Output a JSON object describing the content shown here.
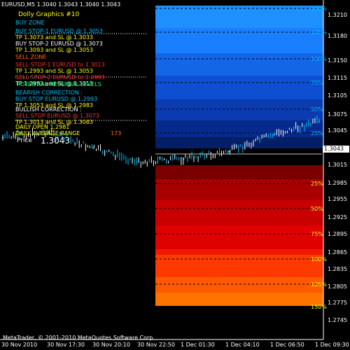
{
  "window": {
    "title": "EURUSD,M5  1.3040 1.3043 1.3040 1.3043"
  },
  "panel": {
    "header": "Dolly Graphics #10",
    "buy_zone": "BUY ZONE",
    "buy_stop1": "BUY STOP-1  EURUSD  @  1.3053",
    "buy_stop1_tp": "TP 1.3073   and SL @  1.3033",
    "buy_stop2": "BUY STOP-2  EURUSD  @  1.3073",
    "buy_stop2_tp": "TP 1.3093   and SL @  1.3053",
    "sell_zone": "SELL ZONE",
    "sell_stop1": "SELL STOP-1  EURUSD  to 1.3013",
    "sell_stop1_tp": "TP 1.2993   and SL @  1.3053",
    "sell_stop2": "SELL STOP-2  EURUSD  to 1.2993",
    "sell_stop2_tp": "TP 1.2983   and SL @  1.3013",
    "reversal": "POTENTIAL REVERSAL LEVELS",
    "bear_title": "BEARISH CORRECTION :",
    "bear_buy": "BUY STOP EURUSD  @   1.2993",
    "bear_tp": "TP 1.3053   and SL @  1.2983",
    "bull_title": "BULLISH CORRECTION :",
    "bull_sell": "SELL STOP EURUSD  @  1.3073",
    "bull_tp": "TP 1.3013   and SL @  1.3083",
    "daily_open": "DAILY OPEN  1.2981",
    "daily_range_label": "DAILY AVERAGE RANGE",
    "daily_range_value": "173",
    "price_label": "Price",
    "price_value": "1.3043"
  },
  "footer": {
    "copyright": "MetaTrader, © 2001-2010 MetaQuotes Software Corp."
  },
  "price_marker": "1.3043",
  "y_axis": [
    "1.3210",
    "1.3180",
    "1.3150",
    "1.3115",
    "1.3105",
    "1.3075",
    "1.3045",
    "1.3015",
    "1.2985",
    "1.2955",
    "1.2925",
    "1.2895",
    "1.2865",
    "1.2835",
    "1.2805",
    "1.2775",
    "1.2745"
  ],
  "x_axis": [
    "30 Nov 2010",
    "30 Nov 17:30",
    "30 Nov 20:10",
    "30 Nov 22:50",
    "1 Dec 01:30",
    "1 Dec 04:10",
    "1 Dec 06:50",
    "1 Dec 09:30"
  ],
  "upper_levels": [
    "150%",
    "125%",
    "100%",
    "75%",
    "50%",
    "25%"
  ],
  "lower_levels": [
    "25%",
    "50%",
    "75%",
    "100%",
    "125%",
    "150%"
  ],
  "colors": {
    "background": "#000000",
    "buy_zone_text": "#00bfff",
    "sell_zone_text": "#ff6a00",
    "header_text": "#ffff00",
    "level_text_upper": "#00bfff",
    "level_text_lower": "#ffff00",
    "candle": "#00c0ff"
  },
  "chart_data": {
    "type": "line",
    "title": "EURUSD,M5  1.3040 1.3043 1.3040 1.3043",
    "x": [
      "30 Nov 2010",
      "30 Nov 17:30",
      "30 Nov 20:10",
      "30 Nov 22:50",
      "1 Dec 01:30",
      "1 Dec 04:10",
      "1 Dec 06:50",
      "1 Dec 09:30"
    ],
    "series": [
      {
        "values": [
          1.302,
          1.3028,
          1.3005,
          1.2985,
          1.299,
          1.3,
          1.3025,
          1.3043
        ]
      }
    ],
    "ylim": [
      1.2745,
      1.321
    ],
    "xlabel": "",
    "ylabel": "",
    "grid": false
  }
}
